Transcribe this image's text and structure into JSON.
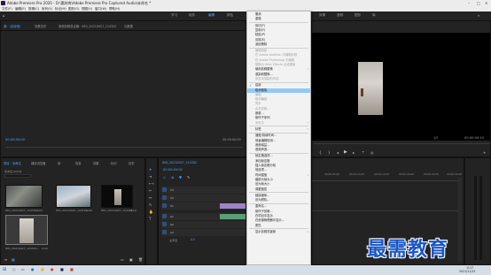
{
  "titlebar": {
    "title": "Adobe Premiere Pro 2020 - D:\\素材库\\Adobe Premiere Pro Captured Audio\\未命名 *"
  },
  "menubar": [
    "文件(F)",
    "编辑(E)",
    "剪辑(C)",
    "序列(S)",
    "标记(M)",
    "图形(G)",
    "视图(V)",
    "窗口(W)",
    "帮助(H)"
  ],
  "workspaces": [
    "学习",
    "组件",
    "编辑",
    "颜色",
    "效果",
    "音频",
    "图形",
    "库"
  ],
  "source_panel": {
    "tabs": [
      "源：(无剪辑)",
      "效果控件",
      "音频剪辑混合器：IMG_20210927_124302",
      "元数据"
    ],
    "timecode": "00:00:00:00",
    "right_timecode": "00:00:00:00"
  },
  "program_panel": {
    "timecode_right": "00:00:09:10",
    "fit_label": "1/2"
  },
  "project_panel": {
    "tabs": [
      "项目：未命名",
      "媒体浏览器",
      "库",
      "信息",
      "效果",
      "标记",
      "历史"
    ],
    "project_file": "未命名.prproj",
    "items": [
      {
        "name": "IMG_20210927_124300...",
        "dur": "4:00"
      },
      {
        "name": "IMG_20210927_124301...",
        "dur": "4:00"
      },
      {
        "name": "IMG_20210927_124302...",
        "dur": "9:10"
      },
      {
        "name": "IMG_20210927_124303...",
        "dur": "4:00"
      }
    ]
  },
  "timeline_panel": {
    "tab": "IMG_20210927_124302",
    "timecode": "00:00:00:00",
    "ruler": [
      "00:00",
      "00:00:05:00",
      "00:00:10:00",
      "00:00:15:00",
      "00:00:20:00",
      "00:00:25:00",
      "00:00:30:00",
      "00:00:35:00"
    ],
    "tracks": [
      "V3",
      "V2",
      "V1",
      "A1",
      "A2",
      "A3"
    ],
    "master": "主声道",
    "master_value": "0.0"
  },
  "context_menu": {
    "items": [
      {
        "label": "撤消",
        "state": "normal"
      },
      {
        "label": "重做",
        "state": "normal"
      },
      {
        "sep": true
      },
      {
        "label": "剪切(T)",
        "state": "normal"
      },
      {
        "label": "复制(Y)",
        "state": "normal"
      },
      {
        "label": "粘贴(P)",
        "state": "normal"
      },
      {
        "label": "清除(E)",
        "state": "normal"
      },
      {
        "label": "波纹删除",
        "state": "normal"
      },
      {
        "sep": true
      },
      {
        "label": "编辑原始",
        "state": "disabled"
      },
      {
        "label": "在 Adobe Audition 中编辑剪辑",
        "state": "disabled"
      },
      {
        "label": "在 Adobe Photoshop 中编辑",
        "state": "disabled"
      },
      {
        "label": "替换为 After Effects 合成图像",
        "state": "disabled"
      },
      {
        "label": "使用剪辑替换",
        "state": "normal",
        "sub": true
      },
      {
        "label": "渲染和替换...",
        "state": "normal"
      },
      {
        "label": "恢复未渲染的内容",
        "state": "disabled"
      },
      {
        "sep": true
      },
      {
        "label": "启用",
        "state": "normal",
        "checked": true
      },
      {
        "label": "取消链接",
        "state": "highlight"
      },
      {
        "label": "编组",
        "state": "disabled"
      },
      {
        "label": "取消编组",
        "state": "disabled"
      },
      {
        "label": "同步",
        "state": "disabled"
      },
      {
        "label": "合并剪辑...",
        "state": "disabled"
      },
      {
        "label": "嵌套...",
        "state": "normal"
      },
      {
        "label": "制作子序列",
        "state": "normal"
      },
      {
        "label": "多机位",
        "state": "disabled",
        "sub": true
      },
      {
        "sep": true
      },
      {
        "label": "标签",
        "state": "normal",
        "sub": true
      },
      {
        "sep": true
      },
      {
        "label": "速度/持续时间...",
        "state": "normal"
      },
      {
        "label": "场景编辑检测...",
        "state": "normal"
      },
      {
        "label": "音频增益...",
        "state": "normal"
      },
      {
        "label": "音频声道...",
        "state": "normal"
      },
      {
        "sep": true
      },
      {
        "label": "帧定格选项...",
        "state": "normal"
      },
      {
        "label": "添加帧定格",
        "state": "normal"
      },
      {
        "label": "插入帧定格分段",
        "state": "normal"
      },
      {
        "label": "场选项...",
        "state": "normal"
      },
      {
        "label": "时间插值",
        "state": "normal",
        "sub": true
      },
      {
        "label": "缩放为帧大小",
        "state": "normal"
      },
      {
        "label": "设为帧大小",
        "state": "normal"
      },
      {
        "label": "调整图层",
        "state": "normal"
      },
      {
        "sep": true
      },
      {
        "label": "链接媒体...",
        "state": "normal"
      },
      {
        "label": "设为脱机...",
        "state": "normal"
      },
      {
        "sep": true
      },
      {
        "label": "重命名...",
        "state": "normal"
      },
      {
        "label": "制作子剪辑...",
        "state": "normal"
      },
      {
        "label": "在项目中显示",
        "state": "normal"
      },
      {
        "label": "在资源管理器中显示...",
        "state": "normal"
      },
      {
        "label": "属性",
        "state": "normal"
      },
      {
        "sep": true
      },
      {
        "label": "显示剪辑关键帧",
        "state": "normal",
        "sub": true
      }
    ]
  },
  "taskbar": {
    "time": "0:17",
    "date": "2021/11/12"
  },
  "watermark": "最需教育"
}
